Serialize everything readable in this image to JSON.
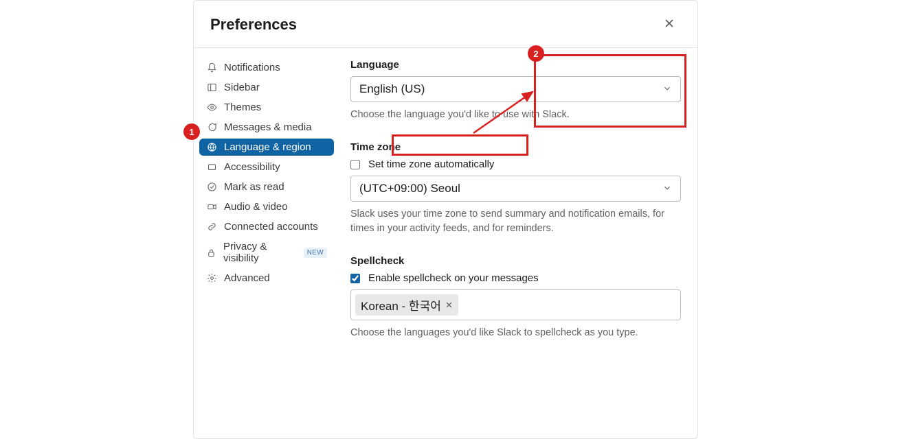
{
  "header": {
    "title": "Preferences"
  },
  "sidebar": {
    "items": [
      {
        "label": "Notifications"
      },
      {
        "label": "Sidebar"
      },
      {
        "label": "Themes"
      },
      {
        "label": "Messages & media"
      },
      {
        "label": "Language & region"
      },
      {
        "label": "Accessibility"
      },
      {
        "label": "Mark as read"
      },
      {
        "label": "Audio & video"
      },
      {
        "label": "Connected accounts"
      },
      {
        "label": "Privacy & visibility",
        "badge": "NEW"
      },
      {
        "label": "Advanced"
      }
    ],
    "active_index": 4
  },
  "language": {
    "label": "Language",
    "value": "English (US)",
    "help": "Choose the language you'd like to use with Slack."
  },
  "timezone": {
    "label": "Time zone",
    "auto_label": "Set time zone automatically",
    "auto_checked": false,
    "value": "(UTC+09:00) Seoul",
    "help": "Slack uses your time zone to send summary and notification emails, for times in your activity feeds, and for reminders."
  },
  "spellcheck": {
    "label": "Spellcheck",
    "enable_label": "Enable spellcheck on your messages",
    "enable_checked": true,
    "chip": "Korean - 한국어",
    "help": "Choose the languages you'd like Slack to spellcheck as you type."
  },
  "annotations": {
    "one": "1",
    "two": "2"
  }
}
